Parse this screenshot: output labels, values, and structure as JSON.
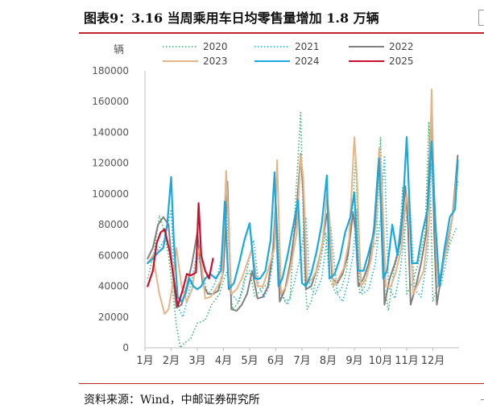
{
  "header": {
    "title": "图表9：3.16 当周乘用车日均零售量增加 1.8 万辆"
  },
  "footer": {
    "source": "资料来源：Wind，中邮证券研究所"
  },
  "chart_data": {
    "type": "line",
    "ylabel": "辆",
    "ylim": [
      0,
      180000
    ],
    "yticks": [
      0,
      20000,
      40000,
      60000,
      80000,
      100000,
      120000,
      140000,
      160000,
      180000
    ],
    "ytick_labels": [
      "0",
      "20000",
      "40000",
      "60000",
      "80000",
      "100000",
      "120000",
      "140000",
      "160000",
      "180000"
    ],
    "xlim": [
      1,
      13
    ],
    "xticks": [
      1,
      2,
      3,
      4,
      5,
      6,
      7,
      8,
      9,
      10,
      11,
      12
    ],
    "xtick_labels": [
      "1月",
      "2月",
      "3月",
      "4月",
      "5月",
      "6月",
      "7月",
      "8月",
      "9月",
      "10月",
      "11月",
      "12月"
    ],
    "grid": false,
    "legend": "top",
    "series": [
      {
        "name": "2020",
        "color": "#3db36b",
        "style": "dotted",
        "width": 1.6,
        "x": [
          1.1,
          1.35,
          1.55,
          1.7,
          1.9,
          2.05,
          2.2,
          2.35,
          2.5,
          2.75,
          3.0,
          3.3,
          3.55,
          3.85,
          4.0,
          4.15,
          4.35,
          4.6,
          4.8,
          5.0,
          5.2,
          5.45,
          5.7,
          5.85,
          6.0,
          6.15,
          6.35,
          6.55,
          6.75,
          6.95,
          7.1,
          7.2,
          7.35,
          7.5,
          7.7,
          7.9,
          8.05,
          8.3,
          8.5,
          8.7,
          8.9,
          9.05,
          9.2,
          9.4,
          9.6,
          9.85,
          10.0,
          10.15,
          10.3,
          10.5,
          10.7,
          10.85,
          11.0,
          11.2,
          11.45,
          11.7,
          11.85,
          12.0,
          12.2,
          12.4,
          12.7,
          12.9
        ],
        "y": [
          45000,
          62000,
          86000,
          78000,
          60000,
          38000,
          15000,
          0,
          3000,
          6000,
          16000,
          18000,
          28000,
          35000,
          44000,
          50000,
          25000,
          30000,
          45000,
          50000,
          33000,
          38000,
          42000,
          52000,
          95000,
          40000,
          30000,
          32000,
          95000,
          153000,
          45000,
          25000,
          30000,
          42000,
          55000,
          75000,
          45000,
          35000,
          38000,
          50000,
          80000,
          125000,
          35000,
          40000,
          60000,
          70000,
          137000,
          40000,
          24000,
          50000,
          62000,
          104000,
          35000,
          42000,
          55000,
          75000,
          147000,
          30000,
          42000,
          55000,
          70000,
          78000
        ]
      },
      {
        "name": "2021",
        "color": "#20aee6",
        "style": "dotted",
        "width": 1.6,
        "x": [
          1.1,
          1.3,
          1.55,
          1.75,
          2.0,
          2.15,
          2.3,
          2.45,
          2.6,
          2.8,
          3.0,
          3.2,
          3.4,
          3.55,
          3.75,
          3.95,
          4.1,
          4.3,
          4.55,
          4.75,
          4.95,
          5.15,
          5.35,
          5.55,
          5.75,
          5.9,
          6.0,
          6.2,
          6.45,
          6.7,
          6.95,
          7.15,
          7.3,
          7.5,
          7.75,
          7.95,
          8.1,
          8.35,
          8.55,
          8.75,
          8.95,
          9.1,
          9.3,
          9.55,
          9.8,
          10.0,
          10.15,
          10.3,
          10.55,
          10.75,
          10.95,
          11.1,
          11.3,
          11.55,
          11.8,
          11.95,
          12.1,
          12.3,
          12.55,
          12.8,
          12.95
        ],
        "y": [
          55000,
          60000,
          65000,
          70000,
          90000,
          35000,
          25000,
          20000,
          30000,
          45000,
          62000,
          48000,
          35000,
          38000,
          45000,
          60000,
          95000,
          35000,
          30000,
          38000,
          55000,
          70000,
          40000,
          33000,
          40000,
          60000,
          95000,
          35000,
          28000,
          42000,
          60000,
          85000,
          40000,
          35000,
          45000,
          70000,
          78000,
          35000,
          30000,
          42000,
          60000,
          90000,
          35000,
          38000,
          55000,
          85000,
          125000,
          40000,
          32000,
          50000,
          78000,
          100000,
          38000,
          33000,
          60000,
          120000,
          55000,
          40000,
          60000,
          90000,
          108000
        ]
      },
      {
        "name": "2022",
        "color": "#808080",
        "style": "solid",
        "width": 2.0,
        "x": [
          1.1,
          1.3,
          1.5,
          1.7,
          1.9,
          2.05,
          2.2,
          2.4,
          2.6,
          2.8,
          3.0,
          3.2,
          3.4,
          3.6,
          3.8,
          4.0,
          4.15,
          4.3,
          4.5,
          4.7,
          4.9,
          5.1,
          5.3,
          5.5,
          5.7,
          5.9,
          6.0,
          6.15,
          6.35,
          6.55,
          6.75,
          6.95,
          7.05,
          7.15,
          7.35,
          7.55,
          7.75,
          7.95,
          8.05,
          8.15,
          8.35,
          8.55,
          8.75,
          8.95,
          9.05,
          9.15,
          9.35,
          9.55,
          9.75,
          9.95,
          10.05,
          10.15,
          10.35,
          10.55,
          10.75,
          10.95,
          11.05,
          11.15,
          11.35,
          11.55,
          11.75,
          11.95,
          12.05,
          12.15,
          12.35,
          12.55,
          12.75,
          12.95
        ],
        "y": [
          58000,
          65000,
          80000,
          85000,
          80000,
          50000,
          26000,
          28000,
          40000,
          55000,
          75000,
          42000,
          35000,
          35000,
          37000,
          50000,
          108000,
          25000,
          24000,
          28000,
          35000,
          50000,
          32000,
          33000,
          40000,
          65000,
          95000,
          30000,
          38000,
          55000,
          80000,
          126000,
          100000,
          38000,
          40000,
          50000,
          65000,
          87000,
          80000,
          45000,
          42000,
          48000,
          60000,
          88000,
          75000,
          40000,
          45000,
          55000,
          78000,
          128000,
          110000,
          28000,
          45000,
          55000,
          68000,
          105000,
          80000,
          28000,
          40000,
          55000,
          75000,
          157000,
          75000,
          28000,
          50000,
          68000,
          85000,
          125000
        ]
      },
      {
        "name": "2023",
        "color": "#e6b587",
        "style": "solid",
        "width": 2.0,
        "x": [
          1.1,
          1.3,
          1.55,
          1.75,
          1.9,
          2.05,
          2.2,
          2.4,
          2.6,
          2.8,
          2.95,
          3.1,
          3.3,
          3.5,
          3.7,
          3.95,
          4.1,
          4.3,
          4.5,
          4.7,
          4.9,
          5.1,
          5.3,
          5.5,
          5.7,
          5.95,
          6.05,
          6.2,
          6.4,
          6.6,
          6.8,
          6.95,
          7.05,
          7.2,
          7.4,
          7.6,
          7.8,
          7.95,
          8.05,
          8.2,
          8.4,
          8.6,
          8.8,
          9.0,
          9.1,
          9.25,
          9.45,
          9.65,
          9.85,
          9.95,
          10.05,
          10.2,
          10.4,
          10.6,
          10.8,
          11.0,
          11.1,
          11.25,
          11.45,
          11.65,
          11.85,
          11.95,
          12.05,
          12.2,
          12.4,
          12.6,
          12.8,
          12.95
        ],
        "y": [
          55000,
          60000,
          35000,
          22000,
          25000,
          40000,
          65000,
          40000,
          30000,
          38000,
          55000,
          65000,
          32000,
          33000,
          38000,
          45000,
          115000,
          35000,
          38000,
          45000,
          55000,
          65000,
          40000,
          40000,
          50000,
          65000,
          122000,
          35000,
          40000,
          55000,
          75000,
          125000,
          110000,
          42000,
          45000,
          52000,
          70000,
          100000,
          85000,
          40000,
          45000,
          52000,
          70000,
          137000,
          110000,
          40000,
          45000,
          58000,
          85000,
          130000,
          110000,
          40000,
          40000,
          50000,
          65000,
          100000,
          85000,
          35000,
          42000,
          50000,
          80000,
          168000,
          100000,
          40000,
          55000,
          70000,
          90000,
          120000
        ]
      },
      {
        "name": "2024",
        "color": "#1ba8dc",
        "style": "solid",
        "width": 2.2,
        "x": [
          1.1,
          1.3,
          1.5,
          1.7,
          1.85,
          2.0,
          2.1,
          2.25,
          2.4,
          2.55,
          2.7,
          2.85,
          3.0,
          3.15,
          3.3,
          3.5,
          3.7,
          3.9,
          4.05,
          4.2,
          4.4,
          4.6,
          4.8,
          5.0,
          5.2,
          5.4,
          5.6,
          5.8,
          5.95,
          6.1,
          6.25,
          6.45,
          6.65,
          6.85,
          7.0,
          7.15,
          7.35,
          7.55,
          7.75,
          7.95,
          8.05,
          8.25,
          8.45,
          8.65,
          8.85,
          9.0,
          9.15,
          9.35,
          9.55,
          9.75,
          9.95,
          10.1,
          10.25,
          10.45,
          10.65,
          10.85,
          11.0,
          11.2,
          11.4,
          11.6,
          11.8,
          11.95,
          12.1,
          12.25,
          12.45,
          12.65,
          12.85,
          12.95
        ],
        "y": [
          55000,
          58000,
          62000,
          65000,
          80000,
          111000,
          70000,
          33000,
          30000,
          35000,
          45000,
          40000,
          38000,
          40000,
          45000,
          48000,
          45000,
          50000,
          95000,
          38000,
          42000,
          55000,
          70000,
          81000,
          45000,
          45000,
          50000,
          70000,
          114000,
          40000,
          45000,
          60000,
          78000,
          96000,
          42000,
          40000,
          48000,
          62000,
          80000,
          112000,
          45000,
          48000,
          58000,
          75000,
          85000,
          101000,
          50000,
          50000,
          62000,
          75000,
          123000,
          45000,
          50000,
          80000,
          60000,
          90000,
          137000,
          55000,
          55000,
          75000,
          90000,
          134000,
          80000,
          40000,
          65000,
          85000,
          90000,
          122000
        ]
      },
      {
        "name": "2025",
        "color": "#c8102e",
        "style": "solid",
        "width": 2.2,
        "x": [
          1.1,
          1.3,
          1.45,
          1.6,
          1.75,
          1.95,
          2.1,
          2.25,
          2.45,
          2.6,
          2.75,
          2.95,
          3.05,
          3.15,
          3.3,
          3.45,
          3.6
        ],
        "y": [
          40000,
          50000,
          68000,
          75000,
          77000,
          62000,
          45000,
          27000,
          38000,
          48000,
          47000,
          49000,
          94000,
          60000,
          50000,
          45000,
          58000
        ]
      }
    ]
  }
}
